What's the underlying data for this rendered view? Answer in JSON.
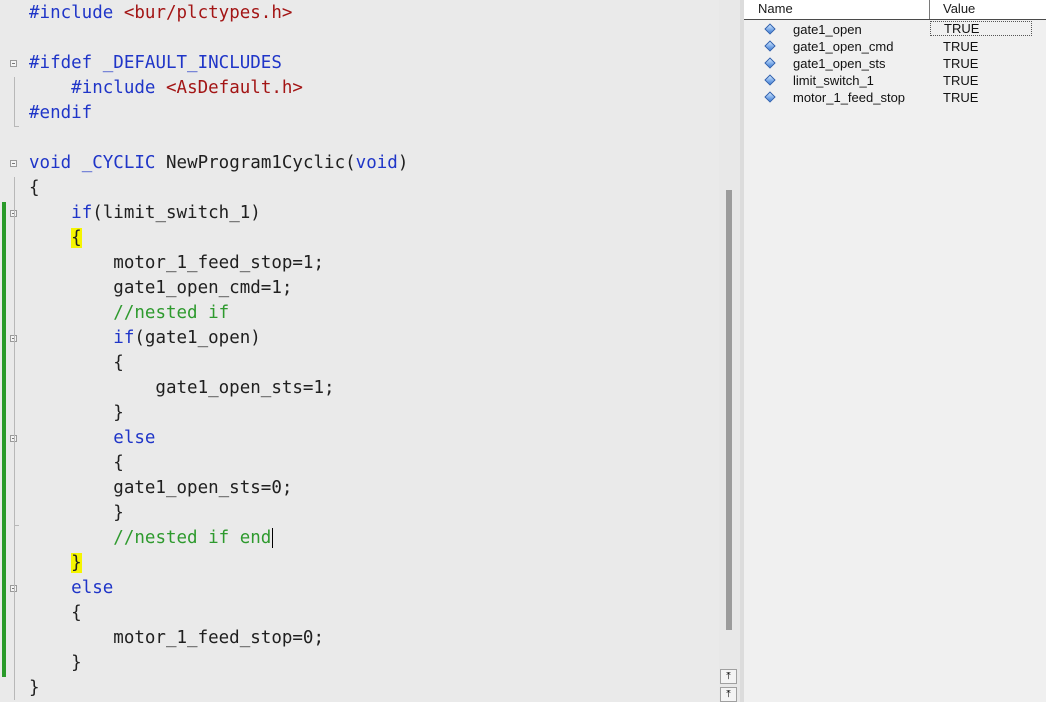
{
  "editor": {
    "lines": [
      [
        {
          "t": "#include",
          "c": "kw"
        },
        {
          "t": " "
        },
        {
          "t": "<bur/plctypes.h>",
          "c": "str"
        }
      ],
      [],
      [
        {
          "t": "#ifdef",
          "c": "kw"
        },
        {
          "t": " "
        },
        {
          "t": "_DEFAULT_INCLUDES",
          "c": "kw"
        }
      ],
      [
        {
          "t": "    "
        },
        {
          "t": "#include",
          "c": "kw"
        },
        {
          "t": " "
        },
        {
          "t": "<AsDefault.h>",
          "c": "str"
        }
      ],
      [
        {
          "t": "#endif",
          "c": "kw"
        }
      ],
      [],
      [
        {
          "t": "void",
          "c": "kw"
        },
        {
          "t": " "
        },
        {
          "t": "_CYCLIC",
          "c": "kw"
        },
        {
          "t": " NewProgram1Cyclic("
        },
        {
          "t": "void",
          "c": "kw"
        },
        {
          "t": ")"
        }
      ],
      [
        {
          "t": "{"
        }
      ],
      [
        {
          "t": "    "
        },
        {
          "t": "if",
          "c": "kw"
        },
        {
          "t": "(limit_switch_1)"
        }
      ],
      [
        {
          "t": "    "
        },
        {
          "t": "{",
          "c": "hl"
        }
      ],
      [
        {
          "t": "        motor_1_feed_stop=1;"
        }
      ],
      [
        {
          "t": "        gate1_open_cmd=1;"
        }
      ],
      [
        {
          "t": "        "
        },
        {
          "t": "//nested if",
          "c": "cm"
        }
      ],
      [
        {
          "t": "        "
        },
        {
          "t": "if",
          "c": "kw"
        },
        {
          "t": "(gate1_open)"
        }
      ],
      [
        {
          "t": "        {"
        }
      ],
      [
        {
          "t": "            gate1_open_sts=1;"
        }
      ],
      [
        {
          "t": "        }"
        }
      ],
      [
        {
          "t": "        "
        },
        {
          "t": "else",
          "c": "kw"
        }
      ],
      [
        {
          "t": "        {"
        }
      ],
      [
        {
          "t": "        gate1_open_sts=0;"
        }
      ],
      [
        {
          "t": "        }"
        }
      ],
      [
        {
          "t": "        "
        },
        {
          "t": "//nested if end",
          "c": "cm"
        },
        {
          "caret": true
        }
      ],
      [
        {
          "t": "    "
        },
        {
          "t": "}",
          "c": "hl"
        }
      ],
      [
        {
          "t": "    "
        },
        {
          "t": "else",
          "c": "kw"
        }
      ],
      [
        {
          "t": "    {"
        }
      ],
      [
        {
          "t": "        motor_1_feed_stop=0;"
        }
      ],
      [
        {
          "t": "    }"
        }
      ],
      [
        {
          "t": "}"
        }
      ]
    ]
  },
  "scrollbar": {
    "top_icon": "scroll-to-top-icon",
    "top_glyph": "⤒",
    "up_icon": "scroll-up-icon",
    "up_glyph": "⤒"
  },
  "watch": {
    "columns": {
      "name": "Name",
      "value": "Value"
    },
    "icon": "variable-diamond-icon",
    "rows": [
      {
        "name": "gate1_open",
        "value": "TRUE"
      },
      {
        "name": "gate1_open_cmd",
        "value": "TRUE"
      },
      {
        "name": "gate1_open_sts",
        "value": "TRUE"
      },
      {
        "name": "limit_switch_1",
        "value": "TRUE"
      },
      {
        "name": "motor_1_feed_stop",
        "value": "TRUE"
      }
    ]
  }
}
